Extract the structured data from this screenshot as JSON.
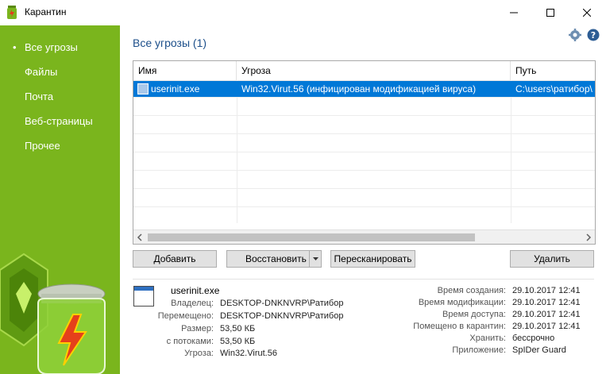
{
  "window": {
    "title": "Карантин",
    "minimize_glyph": "—",
    "maximize_glyph": "☐",
    "close_glyph": "✕"
  },
  "sidebar": {
    "items": [
      {
        "label": "Все угрозы",
        "selected": true
      },
      {
        "label": "Файлы"
      },
      {
        "label": "Почта"
      },
      {
        "label": "Веб-страницы"
      },
      {
        "label": "Прочее"
      }
    ],
    "bullet": "•"
  },
  "main": {
    "heading": "Все угрозы (1)",
    "table": {
      "columns": [
        "Имя",
        "Угроза",
        "Путь"
      ],
      "rows": [
        {
          "name": "userinit.exe",
          "threat": "Win32.Virut.56 (инфицирован модификацией вируса)",
          "path": "C:\\users\\ратибор\\"
        }
      ]
    },
    "buttons": {
      "add": "Добавить",
      "restore": "Восстановить",
      "rescan": "Пересканировать",
      "delete": "Удалить"
    },
    "details": {
      "filename": "userinit.exe",
      "left": [
        {
          "label": "Владелец:",
          "value": "DESKTOP-DNKNVRP\\Ратибор"
        },
        {
          "label": "Перемещено:",
          "value": "DESKTOP-DNKNVRP\\Ратибор"
        },
        {
          "label": "Размер:",
          "value": "53,50 КБ"
        },
        {
          "label": "с потоками:",
          "value": "53,50 КБ"
        },
        {
          "label": "Угроза:",
          "value": "Win32.Virut.56"
        }
      ],
      "right": [
        {
          "label": "Время создания:",
          "value": "29.10.2017 12:41"
        },
        {
          "label": "Время модификации:",
          "value": "29.10.2017 12:41"
        },
        {
          "label": "Время доступа:",
          "value": "29.10.2017 12:41"
        },
        {
          "label": "Помещено в карантин:",
          "value": "29.10.2017 12:41"
        },
        {
          "label": "Хранить:",
          "value": "бессрочно"
        },
        {
          "label": "Приложение:",
          "value": "SpIDer Guard"
        }
      ]
    }
  },
  "colors": {
    "sidebar": "#7ab51d",
    "selection": "#0078d7",
    "heading": "#1c4f8a"
  },
  "icons": [
    "drweb-app-icon",
    "settings-gear-icon",
    "help-icon",
    "chevron-down-icon",
    "file-window-icon"
  ]
}
